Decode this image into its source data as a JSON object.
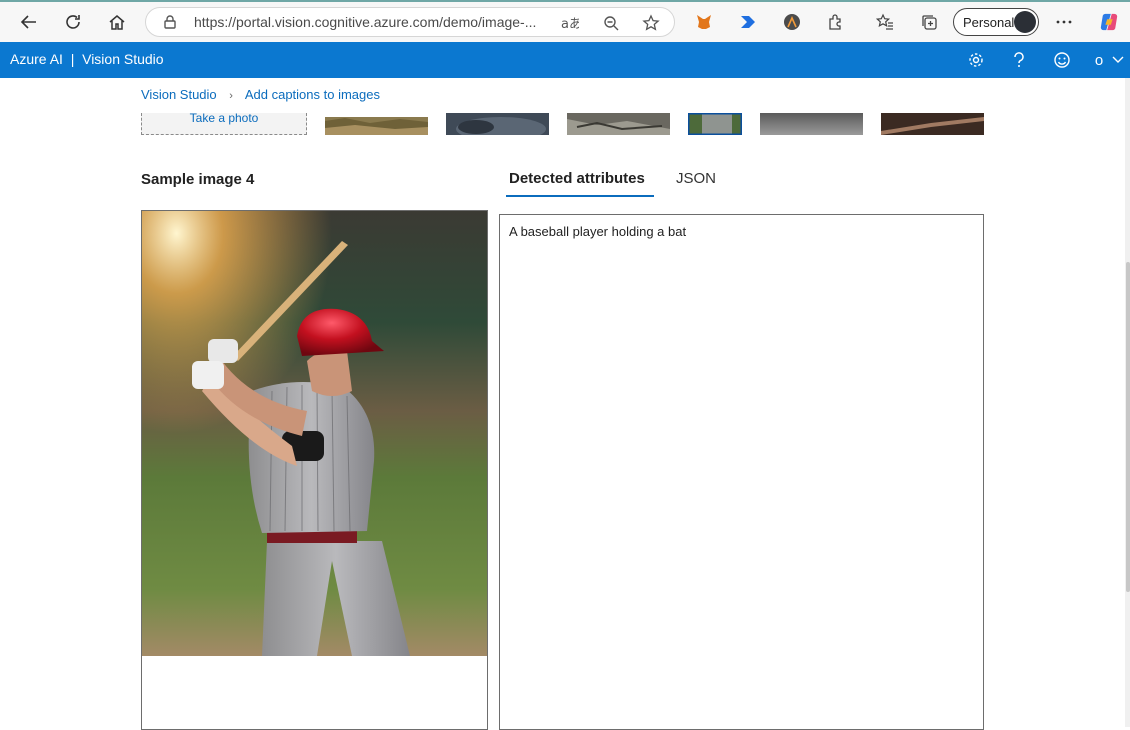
{
  "browser": {
    "url": "https://portal.vision.cognitive.azure.com/demo/image-...",
    "profile_label": "Personal",
    "colors": {
      "tab_strip_accent": "#6fa7a6"
    }
  },
  "header": {
    "title": "Azure AI  |  Vision Studio",
    "account_initial": "o",
    "color": "#0b78d0"
  },
  "breadcrumb": {
    "items": [
      "Vision Studio",
      "Add captions to images"
    ]
  },
  "gallery": {
    "take_photo_label": "Take a photo",
    "thumbnail_count": 7,
    "selected_index": 3
  },
  "sample": {
    "title": "Sample image 4"
  },
  "tabs": {
    "items": [
      "Detected attributes",
      "JSON"
    ],
    "active": 0
  },
  "result": {
    "caption": "A baseball player holding a bat"
  }
}
